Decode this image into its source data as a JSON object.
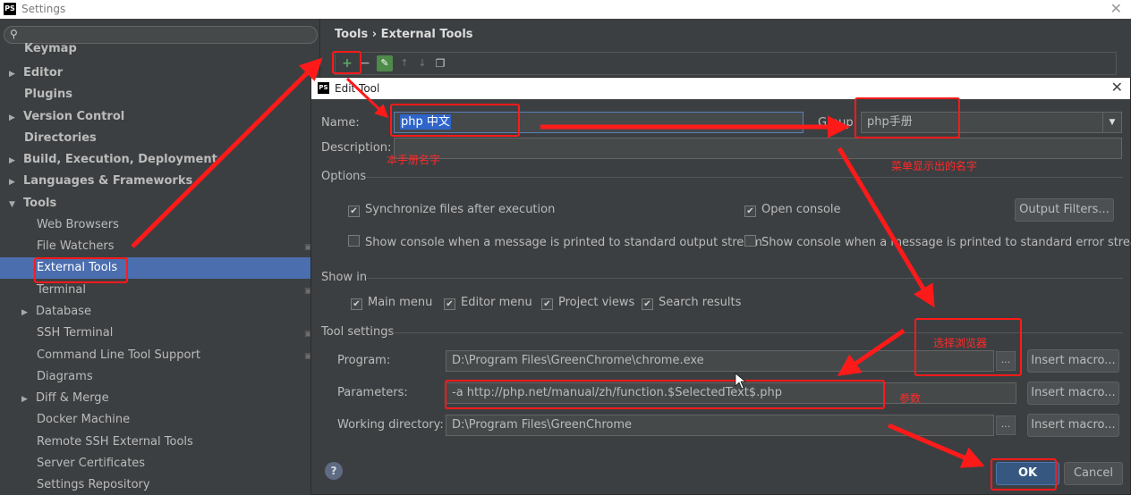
{
  "settings_window": {
    "title": "Settings"
  },
  "search": {
    "placeholder": ""
  },
  "sidebar": {
    "items": [
      {
        "label": "Keymap"
      },
      {
        "label": "Editor"
      },
      {
        "label": "Plugins"
      },
      {
        "label": "Version Control"
      },
      {
        "label": "Directories"
      },
      {
        "label": "Build, Execution, Deployment"
      },
      {
        "label": "Languages & Frameworks"
      },
      {
        "label": "Tools"
      },
      {
        "label": "Web Browsers"
      },
      {
        "label": "File Watchers"
      },
      {
        "label": "External Tools"
      },
      {
        "label": "Terminal"
      },
      {
        "label": "Database"
      },
      {
        "label": "SSH Terminal"
      },
      {
        "label": "Command Line Tool Support"
      },
      {
        "label": "Diagrams"
      },
      {
        "label": "Diff & Merge"
      },
      {
        "label": "Docker Machine"
      },
      {
        "label": "Remote SSH External Tools"
      },
      {
        "label": "Server Certificates"
      },
      {
        "label": "Settings Repository"
      }
    ],
    "selected": "External Tools"
  },
  "breadcrumb": {
    "text": "Tools › External Tools"
  },
  "dialog": {
    "title": "Edit Tool",
    "name_label": "Name:",
    "name_value": "php 中文",
    "group_label": "Group:",
    "group_value": "php手册",
    "description_label": "Description:",
    "description_value": "",
    "options_label": "Options",
    "sync_files": "Synchronize files after execution",
    "open_console": "Open console",
    "output_filters": "Output Filters...",
    "console_stdout": "Show console when a message is printed to standard output stream",
    "console_stderr": "Show console when a message is printed to standard error stream",
    "show_in_label": "Show in",
    "main_menu": "Main menu",
    "editor_menu": "Editor menu",
    "project_views": "Project views",
    "search_results": "Search results",
    "tool_settings_label": "Tool settings",
    "program_label": "Program:",
    "program_value": "D:\\Program Files\\GreenChrome\\chrome.exe",
    "parameters_label": "Parameters:",
    "parameters_value": "-a  http://php.net/manual/zh/function.$SelectedText$.php",
    "working_dir_label": "Working directory:",
    "working_dir_value": "D:\\Program Files\\GreenChrome",
    "insert_macro": "Insert macro...",
    "help": "?",
    "ok": "OK",
    "cancel": "Cancel"
  },
  "annotations": {
    "manual_name": "本手册名字",
    "menu_name": "菜单显示出的名字",
    "select_browser": "选择浏览器",
    "params": "参数"
  },
  "colors": {
    "selection": "#4b6eaf",
    "annotation_red": "#ff1a1a",
    "add_green": "#59a869"
  }
}
